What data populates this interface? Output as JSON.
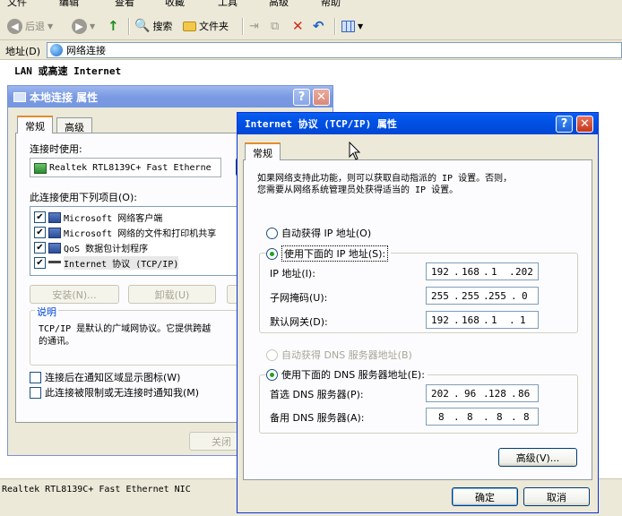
{
  "menubar": {
    "items": [
      "文件",
      "编辑",
      "查看",
      "收藏",
      "工具",
      "高级",
      "帮助"
    ]
  },
  "toolbar": {
    "back_label": "后退",
    "search_label": "搜索",
    "folders_label": "文件夹"
  },
  "address": {
    "label": "地址(D)",
    "value": "网络连接"
  },
  "folder_section_title": "LAN 或高速 Internet",
  "statusbar": {
    "text": "Realtek RTL8139C+ Fast Ethernet NIC"
  },
  "lan_dialog": {
    "title": "本地连接 属性",
    "tabs": [
      "常规",
      "高级"
    ],
    "connect_using_label": "连接时使用:",
    "adapter_name": "Realtek RTL8139C+ Fast Etherne",
    "items_label": "此连接使用下列项目(O):",
    "items": [
      {
        "label": "Microsoft 网络客户端",
        "checked": true
      },
      {
        "label": "Microsoft 网络的文件和打印机共享",
        "checked": true
      },
      {
        "label": "QoS 数据包计划程序",
        "checked": true
      },
      {
        "label": "Internet 协议 (TCP/IP)",
        "checked": true
      }
    ],
    "install_label": "安装(N)...",
    "uninstall_label": "卸载(U)",
    "description_title": "说明",
    "description_text_1": "TCP/IP 是默认的广域网协议。它提供跨越",
    "description_text_2": "的通讯。",
    "show_icon_label": "连接后在通知区域显示图标(W)",
    "notify_label": "此连接被限制或无连接时通知我(M)",
    "close_label": "关闭"
  },
  "tcpip_dialog": {
    "title": "Internet 协议 (TCP/IP) 属性",
    "tab_label": "常规",
    "intro_line1": "如果网络支持此功能，则可以获取自动指派的 IP 设置。否则，",
    "intro_line2": "您需要从网络系统管理员处获得适当的 IP 设置。",
    "auto_ip_label": "自动获得 IP 地址(O)",
    "manual_ip_label": "使用下面的 IP 地址(S):",
    "ip_label": "IP 地址(I):",
    "ip_value": [
      "192",
      "168",
      "1",
      "202"
    ],
    "mask_label": "子网掩码(U):",
    "mask_value": [
      "255",
      "255",
      "255",
      "0"
    ],
    "gateway_label": "默认网关(D):",
    "gateway_value": [
      "192",
      "168",
      "1",
      "1"
    ],
    "auto_dns_label": "自动获得 DNS 服务器地址(B)",
    "manual_dns_label": "使用下面的 DNS 服务器地址(E):",
    "pref_dns_label": "首选 DNS 服务器(P):",
    "pref_dns_value": [
      "202",
      "96",
      "128",
      "86"
    ],
    "alt_dns_label": "备用 DNS 服务器(A):",
    "alt_dns_value": [
      "8",
      "8",
      "8",
      "8"
    ],
    "advanced_label": "高级(V)...",
    "ok_label": "确定",
    "cancel_label": "取消"
  },
  "titlebar_buttons": {
    "help": "?",
    "close": "✕"
  }
}
